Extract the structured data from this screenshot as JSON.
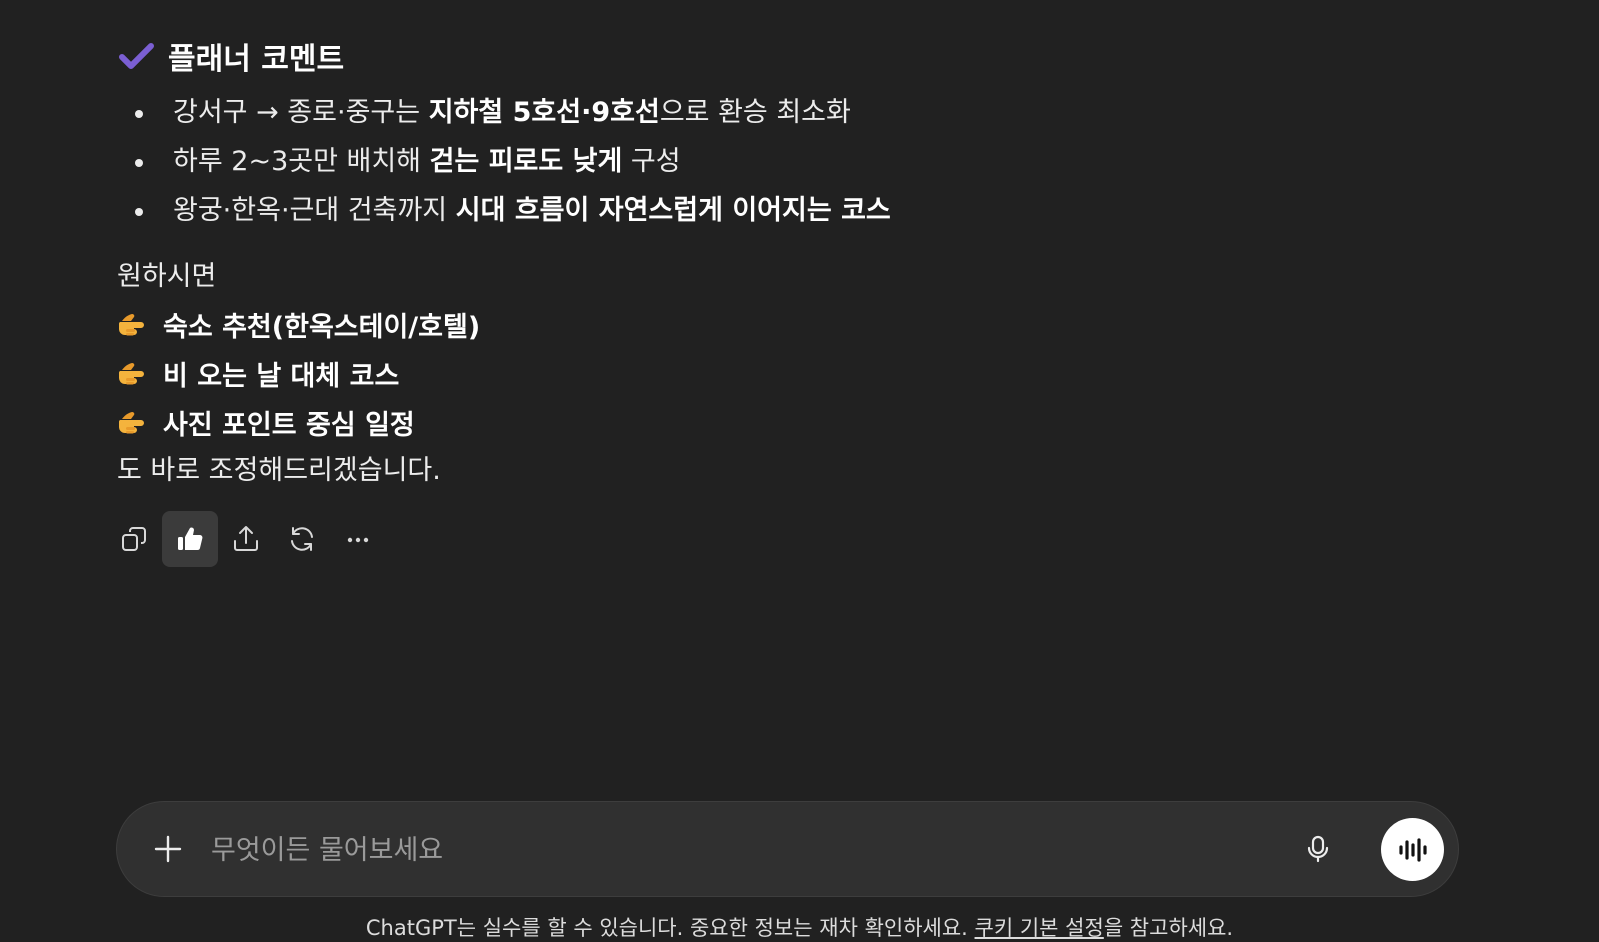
{
  "section": {
    "title": "플래너 코멘트",
    "icon": "check-mark-icon",
    "icon_color": "#7b5fd3"
  },
  "bullets": [
    {
      "pre": "강서구 → 종로·중구는 ",
      "bold": "지하철 5호선·9호선",
      "post": "으로 환승 최소화"
    },
    {
      "pre": "하루 2~3곳만 배치해 ",
      "bold": "걷는 피로도 낮게",
      "post": " 구성"
    },
    {
      "pre": "왕궁·한옥·근대 건축까지 ",
      "bold": "시대 흐름이 자연스럽게 이어지는 코스",
      "post": ""
    }
  ],
  "lead": "원하시면",
  "offers": [
    {
      "icon": "pointing-hand-icon",
      "label": "숙소 추천(한옥스테이/호텔)"
    },
    {
      "icon": "pointing-hand-icon",
      "label": "비 오는 날 대체 코스"
    },
    {
      "icon": "pointing-hand-icon",
      "label": "사진 포인트 중심 일정"
    }
  ],
  "closing": "도 바로 조정해드리겠습니다.",
  "actions": [
    {
      "icon": "copy-icon",
      "active": false
    },
    {
      "icon": "thumbs-up-icon",
      "active": true
    },
    {
      "icon": "share-icon",
      "active": false
    },
    {
      "icon": "regenerate-icon",
      "active": false
    },
    {
      "icon": "more-icon",
      "active": false
    }
  ],
  "composer": {
    "placeholder": "무엇이든 물어보세요",
    "plus_icon": "plus-icon",
    "mic_icon": "microphone-icon",
    "voice_icon": "voice-mode-icon"
  },
  "disclaimer": {
    "text_before": "ChatGPT는 실수를 할 수 있습니다. 중요한 정보는 재차 확인하세요. ",
    "link": "쿠키 기본 설정",
    "text_after": "을 참고하세요."
  }
}
